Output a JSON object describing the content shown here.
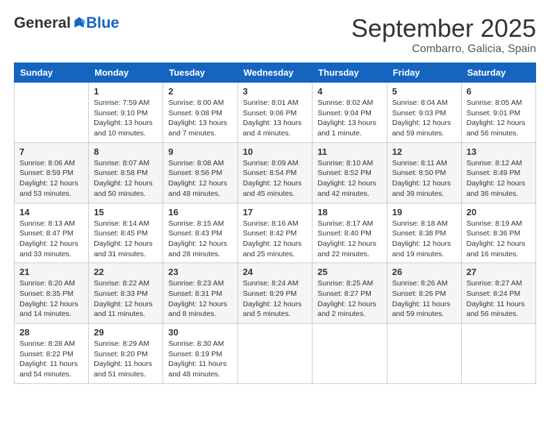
{
  "header": {
    "logo": {
      "general": "General",
      "blue": "Blue"
    },
    "title": "September 2025",
    "location": "Combarro, Galicia, Spain"
  },
  "columns": [
    "Sunday",
    "Monday",
    "Tuesday",
    "Wednesday",
    "Thursday",
    "Friday",
    "Saturday"
  ],
  "weeks": [
    [
      {
        "day": "",
        "info": ""
      },
      {
        "day": "1",
        "info": "Sunrise: 7:59 AM\nSunset: 9:10 PM\nDaylight: 13 hours\nand 10 minutes."
      },
      {
        "day": "2",
        "info": "Sunrise: 8:00 AM\nSunset: 9:08 PM\nDaylight: 13 hours\nand 7 minutes."
      },
      {
        "day": "3",
        "info": "Sunrise: 8:01 AM\nSunset: 9:06 PM\nDaylight: 13 hours\nand 4 minutes."
      },
      {
        "day": "4",
        "info": "Sunrise: 8:02 AM\nSunset: 9:04 PM\nDaylight: 13 hours\nand 1 minute."
      },
      {
        "day": "5",
        "info": "Sunrise: 8:04 AM\nSunset: 9:03 PM\nDaylight: 12 hours\nand 59 minutes."
      },
      {
        "day": "6",
        "info": "Sunrise: 8:05 AM\nSunset: 9:01 PM\nDaylight: 12 hours\nand 56 minutes."
      }
    ],
    [
      {
        "day": "7",
        "info": "Sunrise: 8:06 AM\nSunset: 8:59 PM\nDaylight: 12 hours\nand 53 minutes."
      },
      {
        "day": "8",
        "info": "Sunrise: 8:07 AM\nSunset: 8:58 PM\nDaylight: 12 hours\nand 50 minutes."
      },
      {
        "day": "9",
        "info": "Sunrise: 8:08 AM\nSunset: 8:56 PM\nDaylight: 12 hours\nand 48 minutes."
      },
      {
        "day": "10",
        "info": "Sunrise: 8:09 AM\nSunset: 8:54 PM\nDaylight: 12 hours\nand 45 minutes."
      },
      {
        "day": "11",
        "info": "Sunrise: 8:10 AM\nSunset: 8:52 PM\nDaylight: 12 hours\nand 42 minutes."
      },
      {
        "day": "12",
        "info": "Sunrise: 8:11 AM\nSunset: 8:50 PM\nDaylight: 12 hours\nand 39 minutes."
      },
      {
        "day": "13",
        "info": "Sunrise: 8:12 AM\nSunset: 8:49 PM\nDaylight: 12 hours\nand 36 minutes."
      }
    ],
    [
      {
        "day": "14",
        "info": "Sunrise: 8:13 AM\nSunset: 8:47 PM\nDaylight: 12 hours\nand 33 minutes."
      },
      {
        "day": "15",
        "info": "Sunrise: 8:14 AM\nSunset: 8:45 PM\nDaylight: 12 hours\nand 31 minutes."
      },
      {
        "day": "16",
        "info": "Sunrise: 8:15 AM\nSunset: 8:43 PM\nDaylight: 12 hours\nand 28 minutes."
      },
      {
        "day": "17",
        "info": "Sunrise: 8:16 AM\nSunset: 8:42 PM\nDaylight: 12 hours\nand 25 minutes."
      },
      {
        "day": "18",
        "info": "Sunrise: 8:17 AM\nSunset: 8:40 PM\nDaylight: 12 hours\nand 22 minutes."
      },
      {
        "day": "19",
        "info": "Sunrise: 8:18 AM\nSunset: 8:38 PM\nDaylight: 12 hours\nand 19 minutes."
      },
      {
        "day": "20",
        "info": "Sunrise: 8:19 AM\nSunset: 8:36 PM\nDaylight: 12 hours\nand 16 minutes."
      }
    ],
    [
      {
        "day": "21",
        "info": "Sunrise: 8:20 AM\nSunset: 8:35 PM\nDaylight: 12 hours\nand 14 minutes."
      },
      {
        "day": "22",
        "info": "Sunrise: 8:22 AM\nSunset: 8:33 PM\nDaylight: 12 hours\nand 11 minutes."
      },
      {
        "day": "23",
        "info": "Sunrise: 8:23 AM\nSunset: 8:31 PM\nDaylight: 12 hours\nand 8 minutes."
      },
      {
        "day": "24",
        "info": "Sunrise: 8:24 AM\nSunset: 8:29 PM\nDaylight: 12 hours\nand 5 minutes."
      },
      {
        "day": "25",
        "info": "Sunrise: 8:25 AM\nSunset: 8:27 PM\nDaylight: 12 hours\nand 2 minutes."
      },
      {
        "day": "26",
        "info": "Sunrise: 8:26 AM\nSunset: 8:26 PM\nDaylight: 11 hours\nand 59 minutes."
      },
      {
        "day": "27",
        "info": "Sunrise: 8:27 AM\nSunset: 8:24 PM\nDaylight: 11 hours\nand 56 minutes."
      }
    ],
    [
      {
        "day": "28",
        "info": "Sunrise: 8:28 AM\nSunset: 8:22 PM\nDaylight: 11 hours\nand 54 minutes."
      },
      {
        "day": "29",
        "info": "Sunrise: 8:29 AM\nSunset: 8:20 PM\nDaylight: 11 hours\nand 51 minutes."
      },
      {
        "day": "30",
        "info": "Sunrise: 8:30 AM\nSunset: 8:19 PM\nDaylight: 11 hours\nand 48 minutes."
      },
      {
        "day": "",
        "info": ""
      },
      {
        "day": "",
        "info": ""
      },
      {
        "day": "",
        "info": ""
      },
      {
        "day": "",
        "info": ""
      }
    ]
  ]
}
